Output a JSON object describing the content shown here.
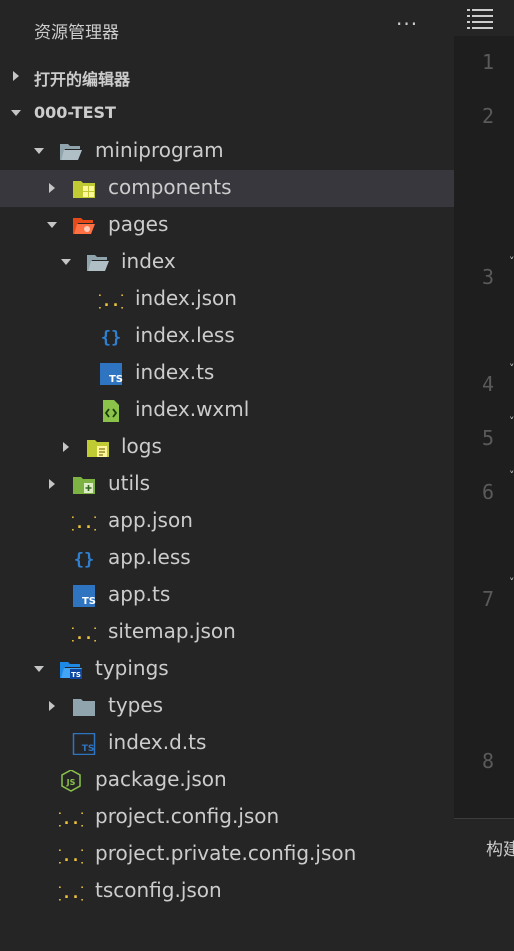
{
  "explorer": {
    "title": "资源管理器",
    "more": "···",
    "open_editors": "打开的编辑器",
    "workspace": "000-TEST",
    "tree": [
      {
        "name": "miniprogram",
        "icon": "folder-open-icon"
      },
      {
        "name": "components",
        "icon": "components-folder-icon"
      },
      {
        "name": "pages",
        "icon": "pages-folder-icon"
      },
      {
        "name": "index",
        "icon": "folder-open-icon"
      },
      {
        "name": "index.json",
        "icon": "json-icon"
      },
      {
        "name": "index.less",
        "icon": "less-icon"
      },
      {
        "name": "index.ts",
        "icon": "typescript-icon"
      },
      {
        "name": "index.wxml",
        "icon": "wxml-icon"
      },
      {
        "name": "logs",
        "icon": "logs-folder-icon"
      },
      {
        "name": "utils",
        "icon": "utils-folder-icon"
      },
      {
        "name": "app.json",
        "icon": "json-icon"
      },
      {
        "name": "app.less",
        "icon": "less-icon"
      },
      {
        "name": "app.ts",
        "icon": "typescript-icon"
      },
      {
        "name": "sitemap.json",
        "icon": "json-icon"
      },
      {
        "name": "typings",
        "icon": "typings-folder-icon"
      },
      {
        "name": "types",
        "icon": "folder-icon"
      },
      {
        "name": "index.d.ts",
        "icon": "typescript-def-icon"
      },
      {
        "name": "package.json",
        "icon": "nodejs-icon"
      },
      {
        "name": "project.config.json",
        "icon": "json-icon"
      },
      {
        "name": "project.private.config.json",
        "icon": "json-icon"
      },
      {
        "name": "tsconfig.json",
        "icon": "json-icon"
      }
    ]
  },
  "editor": {
    "line_numbers": [
      "1",
      "2",
      "3",
      "4",
      "5",
      "6",
      "7",
      "8"
    ],
    "bottom_panel_label": "构建"
  },
  "colors": {
    "sidebar_bg": "#252526",
    "selected_row": "#37373d",
    "editor_bg": "#1e1e1e",
    "json_yellow": "#f0c43a",
    "ts_blue": "#2f74c0",
    "folder_gray": "#8a9ba8"
  }
}
